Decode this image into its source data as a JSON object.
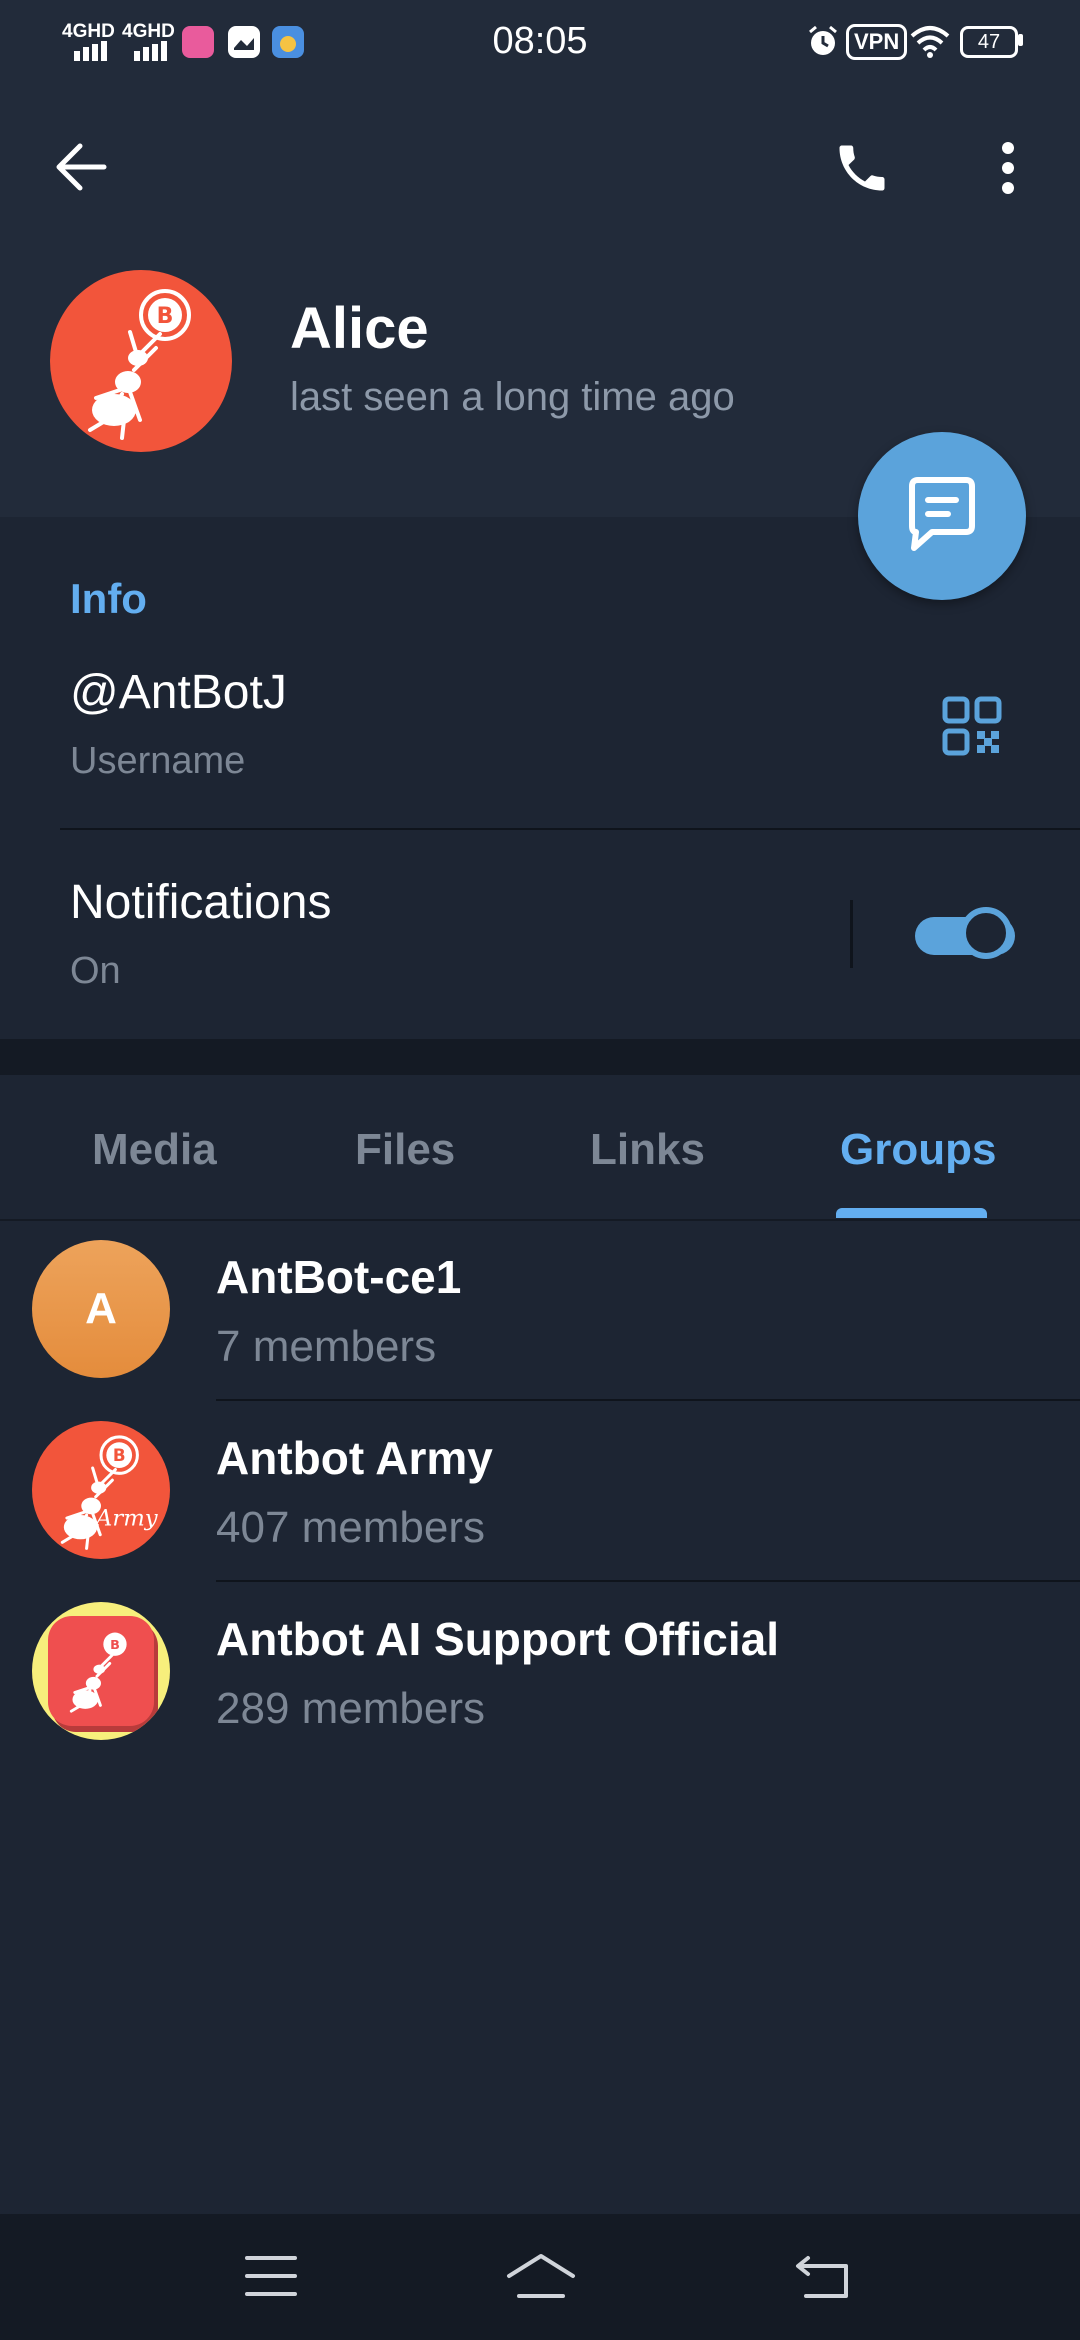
{
  "status_bar": {
    "network_1": "4GHD",
    "network_2": "4GHD",
    "time": "08:05",
    "vpn": "VPN",
    "battery": "47"
  },
  "toolbar": {
    "back_icon": "arrow-left-icon",
    "call_icon": "phone-icon",
    "more_icon": "more-vertical-icon"
  },
  "profile": {
    "name": "Alice",
    "status": "last seen a long time ago",
    "message_button_icon": "chat-bubble-icon"
  },
  "info": {
    "section_label": "Info",
    "username_value": "@AntBotJ",
    "username_caption": "Username",
    "qr_icon": "qr-code-icon",
    "notifications_label": "Notifications",
    "notifications_value": "On",
    "notifications_enabled": true
  },
  "tabs": [
    {
      "label": "Media",
      "active": false
    },
    {
      "label": "Files",
      "active": false
    },
    {
      "label": "Links",
      "active": false
    },
    {
      "label": "Groups",
      "active": true
    }
  ],
  "groups": [
    {
      "name": "AntBot-ce1",
      "members": "7 members",
      "avatar_letter": "A"
    },
    {
      "name": "Antbot Army",
      "members": "407 members",
      "avatar_text": "Army"
    },
    {
      "name": "Antbot AI Support Official",
      "members": "289 members"
    }
  ],
  "colors": {
    "accent": "#63aef0",
    "fab": "#5ba3db",
    "background": "#1d2533",
    "header": "#222b3a",
    "avatar_red": "#f2553b",
    "avatar_orange": "#ea9a48"
  },
  "nav_bar": {
    "menu_icon": "menu-lines-icon",
    "home_icon": "home-icon",
    "back_icon": "back-return-icon"
  }
}
